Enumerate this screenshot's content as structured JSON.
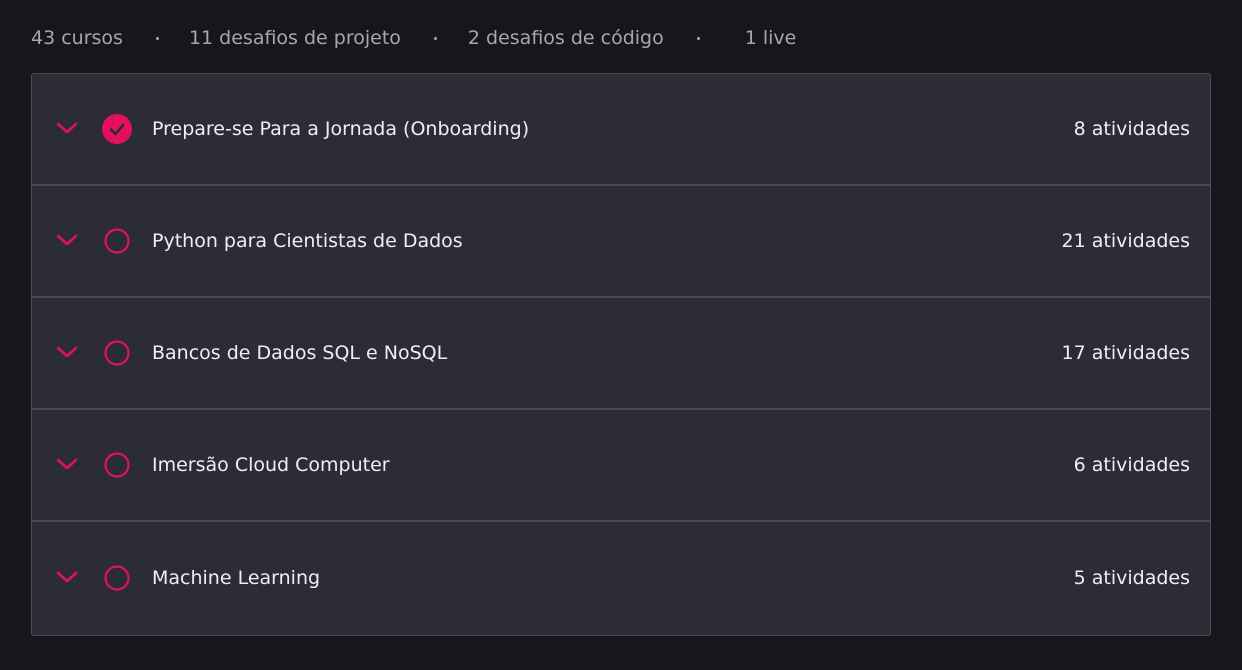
{
  "summary": {
    "courses": "43 cursos",
    "project_challenges": "11 desafios de projeto",
    "code_challenges": "2 desafios de código",
    "lives": "1 live"
  },
  "colors": {
    "accent": "#e4105d",
    "background": "#16161b",
    "panel": "#2c2c37",
    "divider": "#4b4b5a",
    "text": "#eceff4",
    "muted_text": "#a4a7b5"
  },
  "modules": [
    {
      "title": "Prepare-se Para a Jornada (Onboarding)",
      "count": "8 atividades",
      "completed": true,
      "icon": "check-circle-icon"
    },
    {
      "title": "Python para Cientistas de Dados",
      "count": "21 atividades",
      "completed": false,
      "icon": "empty-circle-icon"
    },
    {
      "title": "Bancos de Dados SQL e NoSQL",
      "count": "17 atividades",
      "completed": false,
      "icon": "empty-circle-icon"
    },
    {
      "title": "Imersão Cloud Computer",
      "count": "6 atividades",
      "completed": false,
      "icon": "empty-circle-icon"
    },
    {
      "title": "Machine Learning",
      "count": "5 atividades",
      "completed": false,
      "icon": "empty-circle-icon"
    }
  ]
}
